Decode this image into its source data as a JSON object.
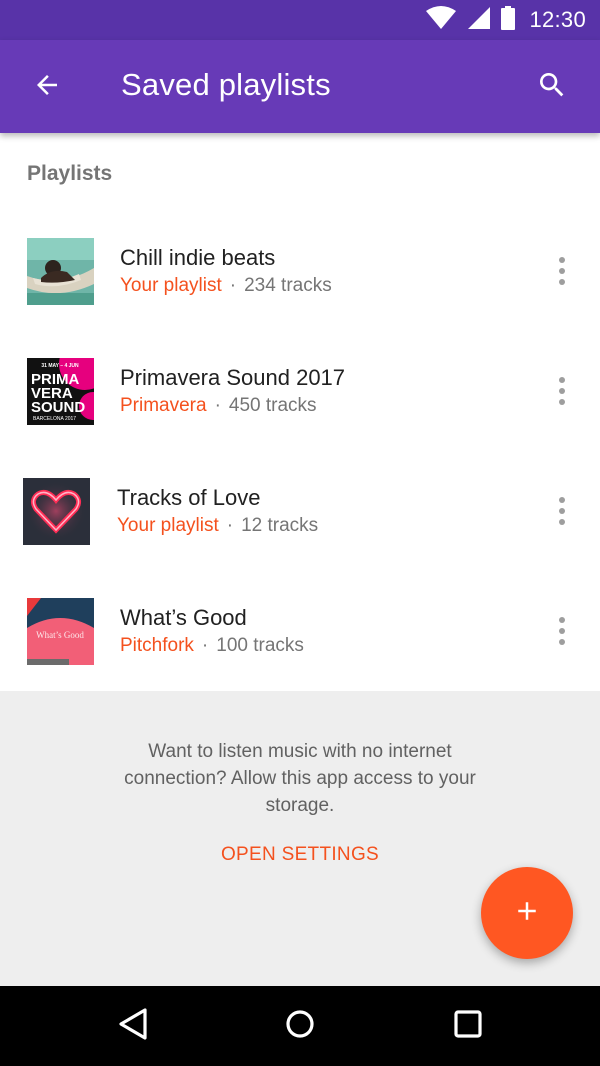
{
  "status_bar": {
    "time": "12:30",
    "icons": [
      "wifi-icon",
      "cell-signal-icon",
      "battery-icon"
    ]
  },
  "app_bar": {
    "title": "Saved playlists",
    "back_icon": "arrow-back-icon",
    "search_icon": "search-icon"
  },
  "section": {
    "header": "Playlists"
  },
  "playlists": [
    {
      "title": "Chill indie beats",
      "owner": "Your playlist",
      "separator": "·",
      "tracks": "234 tracks",
      "cover": "hammock-photo"
    },
    {
      "title": "Primavera Sound 2017",
      "owner": "Primavera",
      "separator": "·",
      "tracks": "450 tracks",
      "cover": "primavera-poster",
      "cover_text": {
        "date": "31 MAY – 4 JUN",
        "lines": [
          "PRIMA",
          "VERA",
          "SOUND"
        ],
        "city": "BARCELONA 2017"
      }
    },
    {
      "title": "Tracks of Love",
      "owner": "Your playlist",
      "separator": "·",
      "tracks": "12 tracks",
      "cover": "neon-heart"
    },
    {
      "title": "What’s Good",
      "owner": "Pitchfork",
      "separator": "·",
      "tracks": "100 tracks",
      "cover": "pitchfork-cover",
      "cover_text": "What’s Good"
    }
  ],
  "info": {
    "message": "Want to listen music with no internet connection? Allow this app access to your storage.",
    "action": "OPEN SETTINGS"
  },
  "fab": {
    "icon": "add-icon"
  },
  "nav_bar": {
    "icons": [
      "back-triangle-icon",
      "home-circle-icon",
      "recents-square-icon"
    ]
  },
  "colors": {
    "status_bar": "#5833a8",
    "app_bar": "#673ab7",
    "accent": "#f4511e",
    "fab": "#ff5722",
    "secondary_text": "#757575",
    "primary_text": "#212121",
    "background": "#eeeeee"
  }
}
